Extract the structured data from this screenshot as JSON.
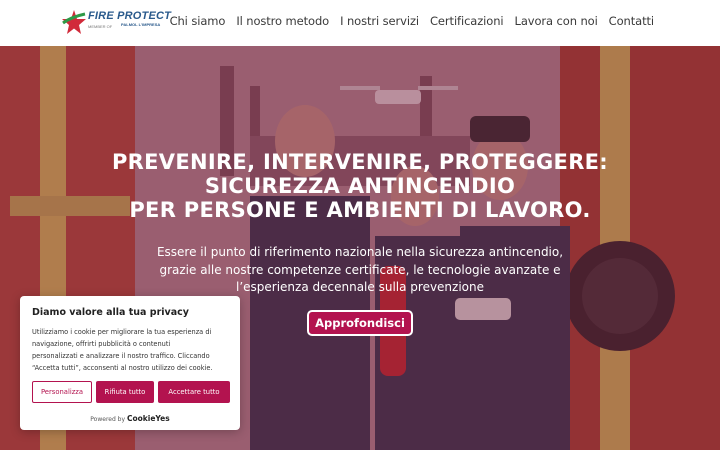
{
  "header": {
    "logo": {
      "name": "FIRE PROTECT",
      "subtext": "MEMBER OF",
      "mark": "PALMOL L'IMPRESA"
    },
    "nav": [
      "Chi siamo",
      "Il nostro metodo",
      "I nostri servizi",
      "Certificazioni",
      "Lavora con noi",
      "Contatti"
    ]
  },
  "hero": {
    "title_lines": [
      "PREVENIRE, INTERVENIRE, PROTEGGERE:",
      "SICUREZZA ANTINCENDIO",
      "PER PERSONE E AMBIENTI DI LAVORO."
    ],
    "text_lines": [
      "Essere il punto di riferimento nazionale nella sicurezza antincendio,",
      "grazie alle nostre competenze certificate, le tecnologie avanzate e",
      "l’esperienza decennale sulla prevenzione"
    ],
    "cta_label": "Approfondisci"
  },
  "cookie": {
    "title": "Diamo valore alla tua privacy",
    "text_lines": [
      "Utilizziamo i cookie per migliorare la tua esperienza di",
      "navigazione, offrirti pubblicità o contenuti",
      "personalizzati e analizzare il nostro traffico. Cliccando",
      "“Accetta tutti”, acconsenti al nostro utilizzo dei cookie."
    ],
    "buttons": {
      "customize": "Personalizza",
      "reject": "Rifiuta tutto",
      "accept": "Accettare tutto"
    },
    "powered_prefix": "Powered by",
    "powered_brand": "CookieYes"
  },
  "colors": {
    "accent": "#b3134f",
    "logo_blue": "#2a5a8c",
    "logo_green": "#2e9a47",
    "logo_red": "#d12a3a"
  }
}
